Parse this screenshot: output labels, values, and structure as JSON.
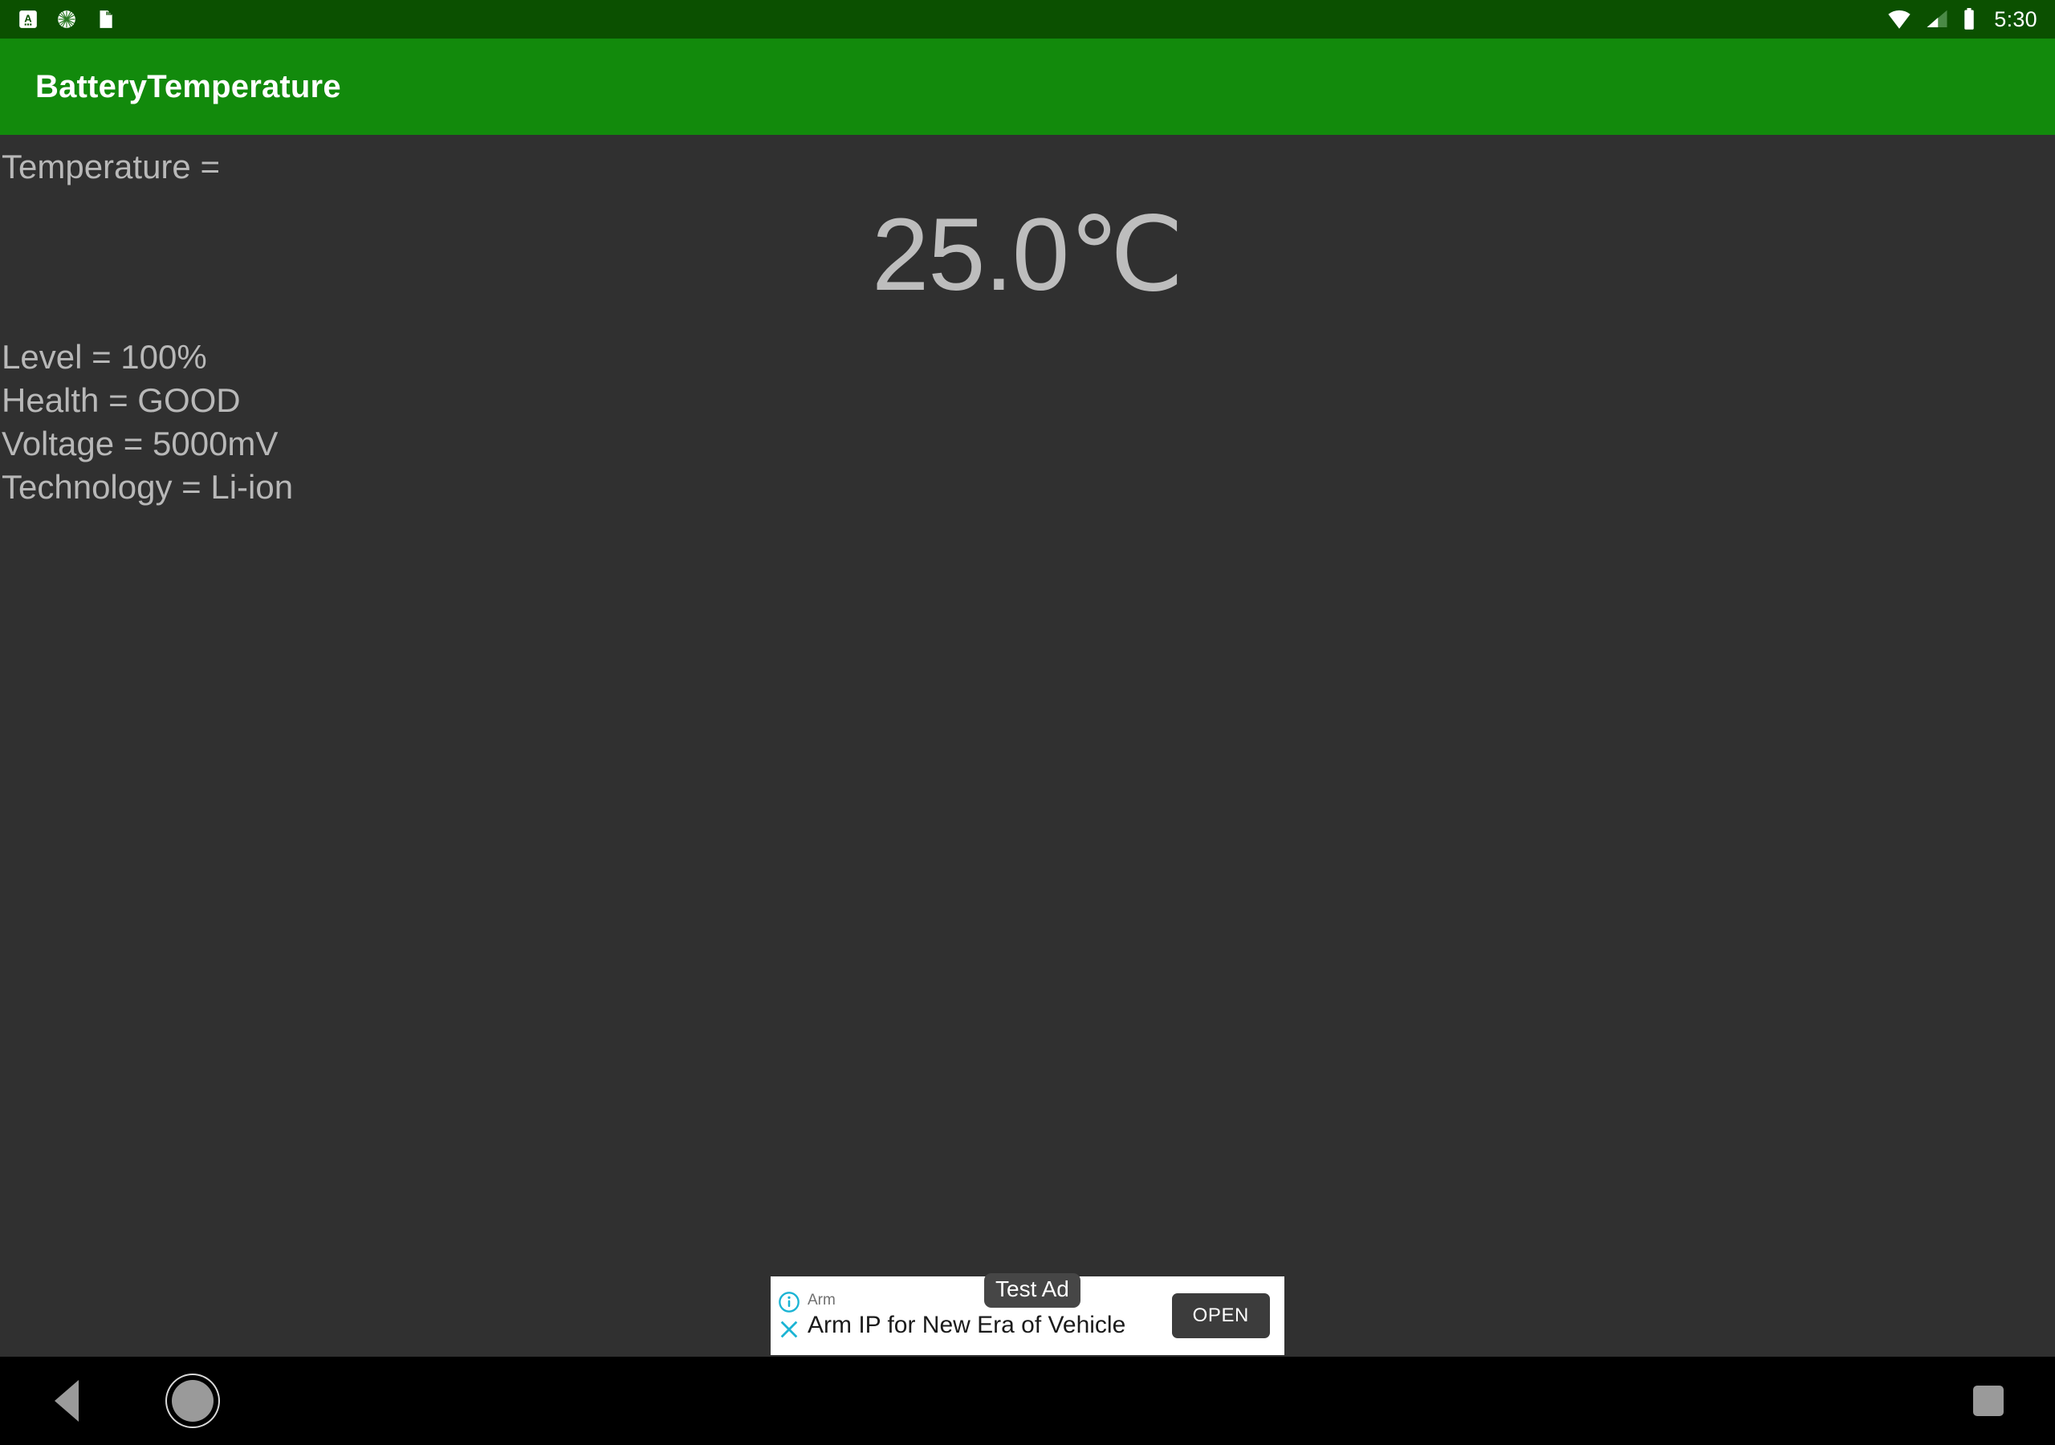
{
  "status_bar": {
    "background_color": "#0B5000",
    "clock": "5:30",
    "notification_icons": [
      "keyboard-language-icon",
      "sun-brightness-icon",
      "sd-card-icon"
    ],
    "system_icons": [
      "wifi-icon",
      "cell-signal-icon",
      "battery-icon"
    ]
  },
  "app_bar": {
    "title": "BatteryTemperature",
    "background_color": "#128A0C",
    "text_color": "#FFFFFF"
  },
  "content": {
    "background_color": "#303030",
    "text_color": "#B8B8B8",
    "temperature_label": "Temperature =",
    "temperature_value": "25.0℃",
    "info": [
      {
        "key": "Level",
        "value": "100%",
        "line": "Level = 100%"
      },
      {
        "key": "Health",
        "value": "GOOD",
        "line": "Health = GOOD"
      },
      {
        "key": "Voltage",
        "value": "5000mV",
        "line": "Voltage = 5000mV"
      },
      {
        "key": "Technology",
        "value": "Li-ion",
        "line": "Technology = Li-ion"
      }
    ]
  },
  "ad_banner": {
    "test_badge": "Test Ad",
    "advertiser": "Arm",
    "headline": "Arm IP for New Era of Vehicle",
    "cta_label": "OPEN",
    "info_icon": "ad-info-icon",
    "close_icon": "ad-close-icon",
    "accent_color": "#1BB4D4",
    "background_color": "#FFFFFF"
  },
  "nav_bar": {
    "background_color": "#000000",
    "buttons": [
      {
        "name": "back",
        "icon": "back-triangle-icon"
      },
      {
        "name": "home",
        "icon": "home-circle-icon"
      },
      {
        "name": "recents",
        "icon": "recents-square-icon"
      }
    ]
  }
}
